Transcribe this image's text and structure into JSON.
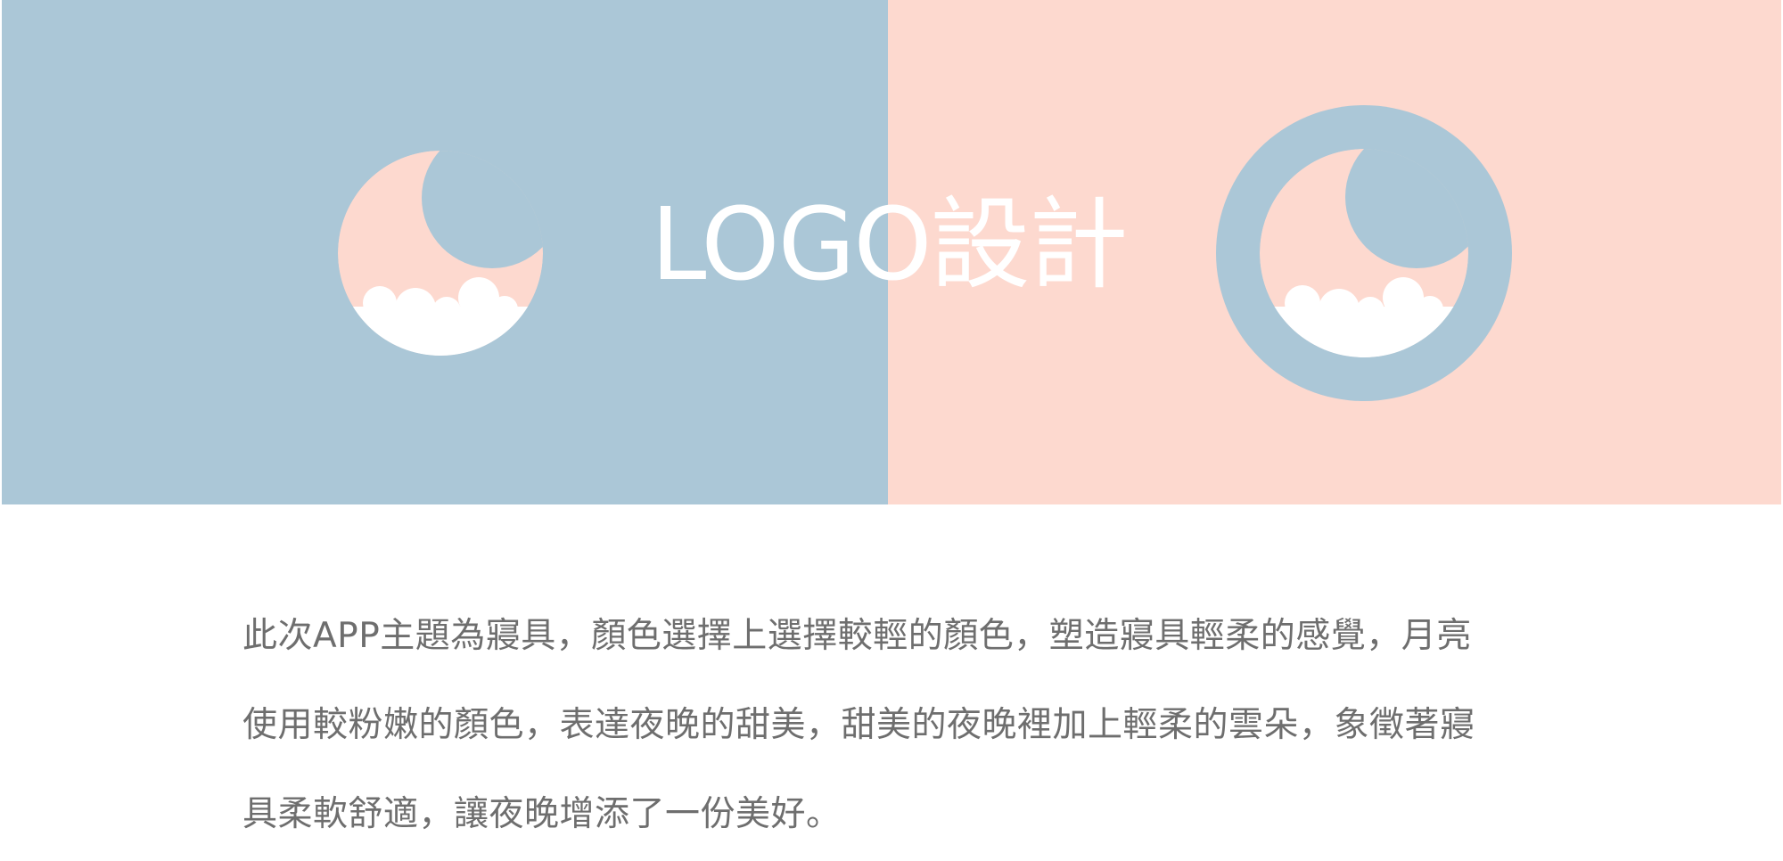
{
  "banner": {
    "title": "LOGO設計",
    "colors": {
      "blue": "#abc7d7",
      "pink": "#fdd9cf",
      "cloud": "#ffffff"
    },
    "logos": [
      {
        "name": "moon-cloud-logo",
        "variant": "pink moon on blue"
      },
      {
        "name": "moon-cloud-logo",
        "variant": "blue ring moon on pink"
      }
    ]
  },
  "description": {
    "lines": [
      "此次APP主題為寢具，顏色選擇上選擇較輕的顏色，塑造寢具輕柔的感覺，月亮",
      "使用較粉嫩的顏色，表達夜晚的甜美，甜美的夜晚裡加上輕柔的雲朵，象徵著寢",
      "具柔軟舒適，讓夜晚增添了一份美好。"
    ]
  }
}
